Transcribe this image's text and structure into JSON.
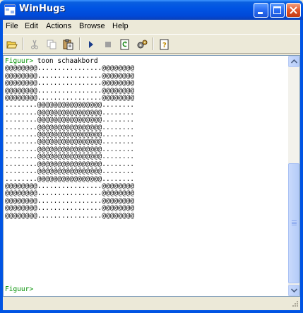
{
  "window": {
    "title": "WinHugs",
    "buttons": [
      "minimize",
      "maximize",
      "close"
    ]
  },
  "menu": {
    "items": [
      "File",
      "Edit",
      "Actions",
      "Browse",
      "Help"
    ]
  },
  "toolbar": {
    "tools": [
      {
        "name": "open-icon",
        "enabled": true
      },
      {
        "name": "cut-icon",
        "enabled": false
      },
      {
        "name": "copy-icon",
        "enabled": false
      },
      {
        "name": "paste-icon",
        "enabled": true
      },
      {
        "name": "run-icon",
        "enabled": true
      },
      {
        "name": "stop-icon",
        "enabled": false
      },
      {
        "name": "reload-icon",
        "enabled": true
      },
      {
        "name": "options-icon",
        "enabled": true
      },
      {
        "name": "help-icon",
        "enabled": true
      }
    ]
  },
  "console": {
    "prompt": "Figuur>",
    "command": " toon schaakbord",
    "lines": [
      "@@@@@@@@................@@@@@@@@",
      "@@@@@@@@................@@@@@@@@",
      "@@@@@@@@................@@@@@@@@",
      "@@@@@@@@................@@@@@@@@",
      "@@@@@@@@................@@@@@@@@",
      "........@@@@@@@@@@@@@@@@........",
      "........@@@@@@@@@@@@@@@@........",
      "........@@@@@@@@@@@@@@@@........",
      "........@@@@@@@@@@@@@@@@........",
      "........@@@@@@@@@@@@@@@@........",
      "........@@@@@@@@@@@@@@@@........",
      "........@@@@@@@@@@@@@@@@........",
      "........@@@@@@@@@@@@@@@@........",
      "........@@@@@@@@@@@@@@@@........",
      "........@@@@@@@@@@@@@@@@........",
      "........@@@@@@@@@@@@@@@@........",
      "@@@@@@@@................@@@@@@@@",
      "@@@@@@@@................@@@@@@@@",
      "@@@@@@@@................@@@@@@@@",
      "@@@@@@@@................@@@@@@@@",
      "@@@@@@@@................@@@@@@@@"
    ],
    "bottom_prompt": "Figuur>"
  },
  "colors": {
    "prompt": "#009000",
    "titlebar": "#0054e3",
    "window_bg": "#ece9d8"
  },
  "scrollbar": {
    "position": 0.78
  }
}
